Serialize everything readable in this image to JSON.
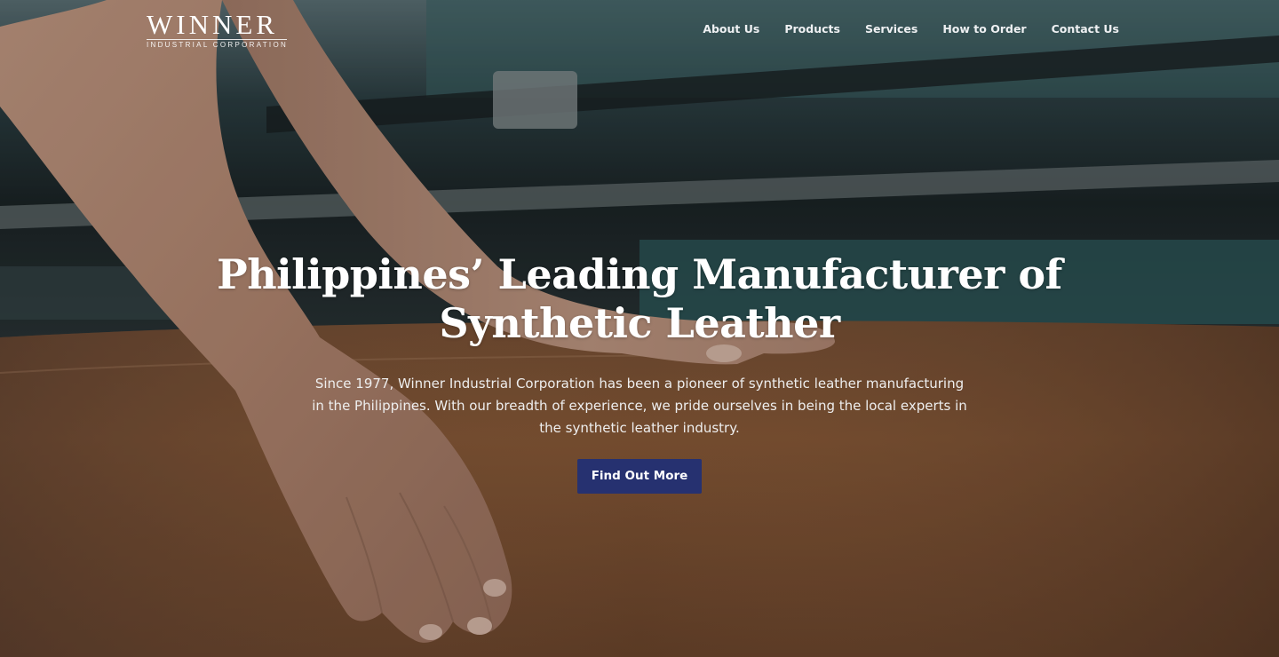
{
  "logo": {
    "name": "WINNER",
    "tagline": "INDUSTRIAL CORPORATION"
  },
  "nav": {
    "items": [
      {
        "label": "About Us"
      },
      {
        "label": "Products"
      },
      {
        "label": "Services"
      },
      {
        "label": "How to Order"
      },
      {
        "label": "Contact Us"
      }
    ]
  },
  "hero": {
    "headline": "Philippines’ Leading Manufacturer of Synthetic Leather",
    "description": "Since 1977, Winner Industrial Corporation has been a pioneer of synthetic leather manufacturing in the Philippines. With our breadth of experience, we pride ourselves in being the local experts in the synthetic leather industry.",
    "cta_label": "Find Out More",
    "background_image": "hands-on-leather-photo"
  },
  "colors": {
    "cta_background": "#263170",
    "text": "#ffffff",
    "leather": "#8a5a38",
    "machine_teal": "#2f5558"
  }
}
